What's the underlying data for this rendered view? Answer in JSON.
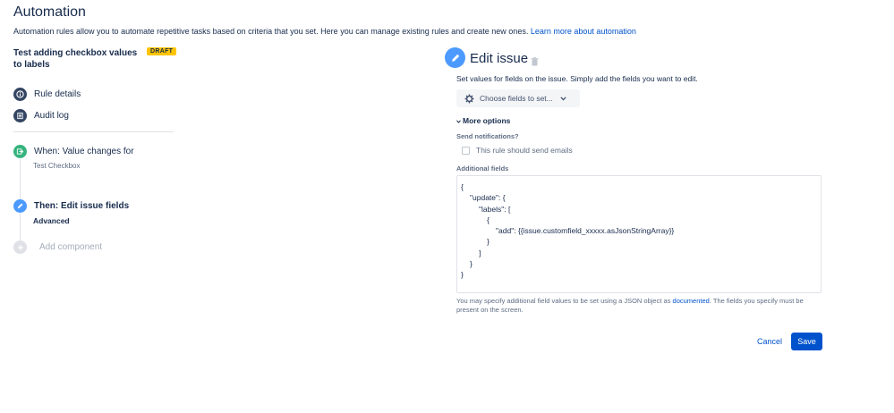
{
  "page": {
    "title": "Automation",
    "intro_text": "Automation rules allow you to automate repetitive tasks based on criteria that you set. Here you can manage existing rules and create new ones.",
    "learn_more_link": "Learn more about automation"
  },
  "rule": {
    "name": "Test adding checkbox values to labels",
    "status_badge": "DRAFT"
  },
  "sidebar": {
    "items": [
      {
        "label": "Rule details",
        "icon": "info-icon"
      },
      {
        "label": "Audit log",
        "icon": "document-icon"
      }
    ],
    "trigger": {
      "label": "When: Value changes for",
      "detail": "Test Checkbox",
      "icon": "trigger-icon"
    },
    "action": {
      "label": "Then: Edit issue fields",
      "detail": "Advanced",
      "icon": "pencil-icon"
    },
    "add_component": {
      "label": "Add component",
      "icon": "plus-icon"
    }
  },
  "editor": {
    "title": "Edit issue",
    "description": "Set values for fields on the issue. Simply add the fields you want to edit.",
    "choose_fields_label": "Choose fields to set...",
    "more_options_label": "More options",
    "send_notifications_label": "Send notifications?",
    "send_emails_checkbox_label": "This rule should send emails",
    "send_emails_checked": false,
    "additional_fields_label": "Additional fields",
    "json_lines": [
      "{",
      "\"update\": {",
      "\"labels\": [",
      "{",
      "\"add\": {{issue.customfield_xxxxx.asJsonStringArray}}",
      "}",
      "]",
      "}",
      "}"
    ],
    "helper_text_before": "You may specify additional field values to be set using a JSON object as",
    "helper_link": "documented",
    "helper_text_after": ". The fields you specify must be present on the screen.",
    "cancel_label": "Cancel",
    "save_label": "Save"
  },
  "colors": {
    "primary": "#0052cc",
    "draft_badge": "#ffc400",
    "trigger_green": "#36b37e",
    "action_blue": "#4c9aff",
    "dark_icon": "#344563"
  }
}
